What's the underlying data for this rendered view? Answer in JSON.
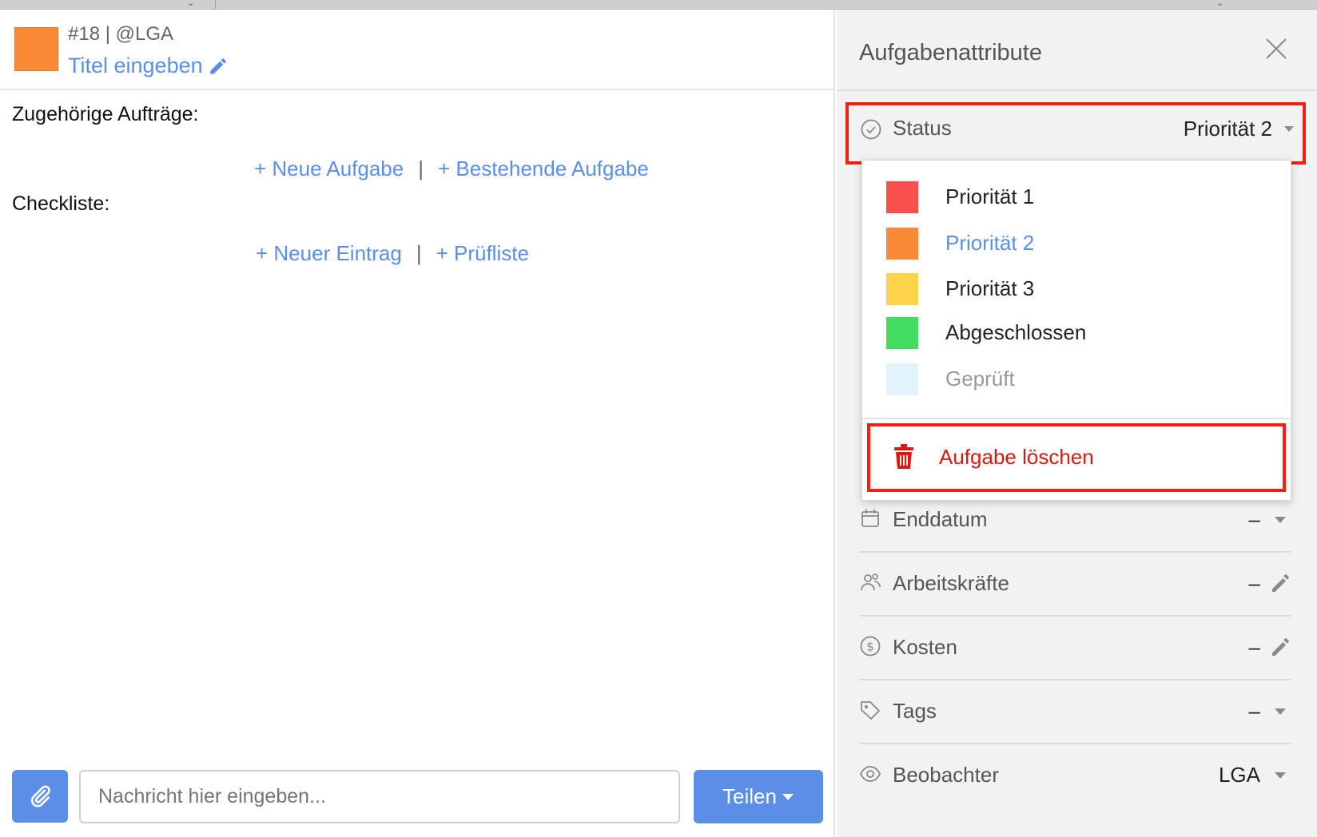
{
  "task": {
    "id_line": "#18 | @LGA",
    "title_placeholder": "Titel eingeben",
    "color": "#fb8a37"
  },
  "sections": {
    "related_label": "Zugehörige Aufträge:",
    "new_task_link": "+ Neue Aufgabe",
    "existing_task_link": "+ Bestehende Aufgabe",
    "checklist_label": "Checkliste:",
    "new_entry_link": "+ Neuer Eintrag",
    "checklist_template_link": "+ Prüfliste",
    "separator": "|"
  },
  "composer": {
    "placeholder": "Nachricht hier eingeben...",
    "share_label": "Teilen"
  },
  "panel": {
    "title": "Aufgabenattribute",
    "status": {
      "label": "Status",
      "value": "Priorität 2"
    },
    "status_options": [
      {
        "label": "Priorität 1",
        "color": "#fc4f4f"
      },
      {
        "label": "Priorität 2",
        "color": "#fb8a37",
        "selected": true
      },
      {
        "label": "Priorität 3",
        "color": "#fdd54a"
      },
      {
        "label": "Abgeschlossen",
        "color": "#43dc63"
      },
      {
        "label": "Geprüft",
        "color": "#e3f3fd"
      }
    ],
    "delete_label": "Aufgabe löschen",
    "attributes": [
      {
        "label": "Enddatum",
        "value": "–",
        "icon": "calendar-icon",
        "action": "chevron-down-icon"
      },
      {
        "label": "Arbeitskräfte",
        "value": "–",
        "icon": "people-icon",
        "action": "pencil-icon"
      },
      {
        "label": "Kosten",
        "value": "–",
        "icon": "dollar-icon",
        "action": "pencil-icon"
      },
      {
        "label": "Tags",
        "value": "–",
        "icon": "tag-icon",
        "action": "chevron-down-icon"
      },
      {
        "label": "Beobachter",
        "value": "LGA",
        "icon": "eye-icon",
        "action": "chevron-down-icon"
      }
    ]
  },
  "colors": {
    "accent": "#5b8fe6",
    "highlight": "#f2210f",
    "danger": "#d71a12"
  }
}
